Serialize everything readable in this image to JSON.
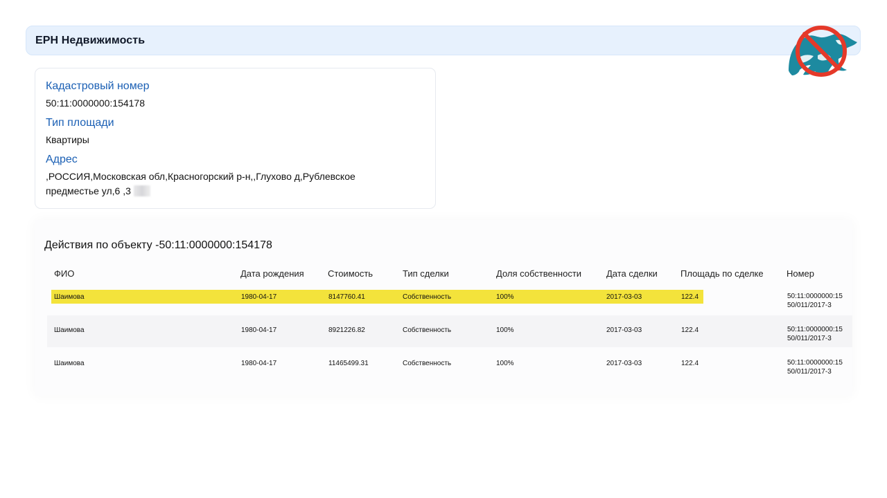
{
  "header": {
    "title": "ЕРН Недвижимость"
  },
  "logo": {
    "icon_name": "crossed-out-bear-logo",
    "colors": {
      "bear": "#1d8aa0",
      "cross": "#e53929"
    }
  },
  "info_card": {
    "cadastral_label": "Кадастровый номер",
    "cadastral_value": "50:11:0000000:154178",
    "area_type_label": "Тип площади",
    "area_type_value": "Квартиры",
    "address_label": "Адрес",
    "address_value": ",РОССИЯ,Московская обл,Красногорский р-н,,Глухово д,Рублевское предместье ул,6 ,3"
  },
  "actions": {
    "title": "Действия по объекту -50:11:0000000:154178",
    "columns": [
      "ФИО",
      "Дата рождения",
      "Стоимость",
      "Тип сделки",
      "Доля собственности",
      "Дата сделки",
      "Площадь по сделке",
      "Номер"
    ],
    "rows": [
      {
        "fio": "Шаимова",
        "birth_date": "1980-04-17",
        "cost": "8147760.41",
        "deal_type": "Собственность",
        "ownership_share": "100%",
        "deal_date": "2017-03-03",
        "deal_area": "122.4",
        "number_line1": "50:11:0000000:15",
        "number_line2": "50/011/2017-3"
      },
      {
        "fio": "Шаимова",
        "birth_date": "1980-04-17",
        "cost": "8921226.82",
        "deal_type": "Собственность",
        "ownership_share": "100%",
        "deal_date": "2017-03-03",
        "deal_area": "122.4",
        "number_line1": "50:11:0000000:15",
        "number_line2": "50/011/2017-3"
      },
      {
        "fio": "Шаимова",
        "birth_date": "1980-04-17",
        "cost": "11465499.31",
        "deal_type": "Собственность",
        "ownership_share": "100%",
        "deal_date": "2017-03-03",
        "deal_area": "122.4",
        "number_line1": "50:11:0000000:15",
        "number_line2": "50/011/2017-3"
      }
    ]
  },
  "colors": {
    "header_bg": "#e7f1fd",
    "label_blue": "#1a5fb4",
    "highlight_yellow": "#f3e33b"
  }
}
